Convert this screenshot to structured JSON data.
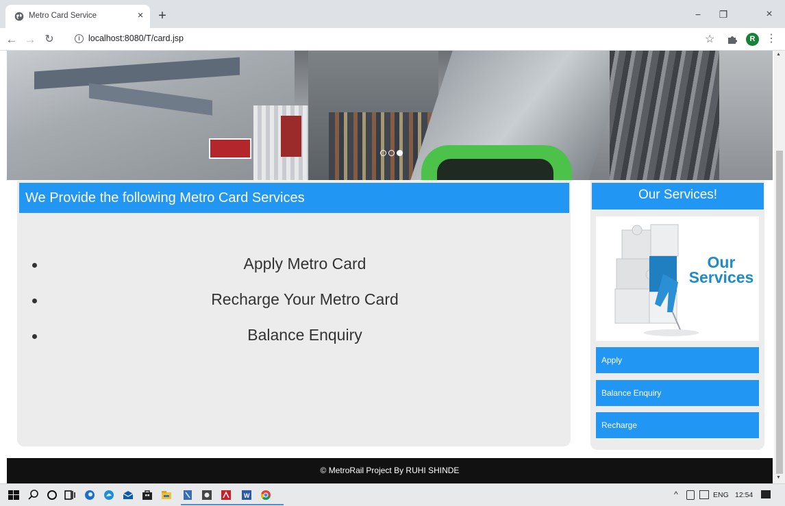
{
  "browser": {
    "tab_title": "Metro Card Service",
    "tab_close": "×",
    "new_tab": "+",
    "url": "localhost:8080/T/card.jsp",
    "profile_initial": "R",
    "window_minimize": "−",
    "window_restore": "❐",
    "window_close": "×"
  },
  "banner": {
    "carousel_total_slides": 3,
    "carousel_active_slide": 3
  },
  "main": {
    "heading": "We Provide the following Metro Card Services",
    "services": [
      "Apply Metro Card",
      "Recharge Your Metro Card",
      "Balance Enquiry"
    ]
  },
  "sidebar": {
    "heading": "Our Services!",
    "image_text_line1": "Our",
    "image_text_line2": "Services",
    "buttons": [
      "Apply",
      "Balance Enquiry",
      "Recharge"
    ]
  },
  "footer": {
    "text": "© MetroRail Project By RUHI SHINDE"
  },
  "taskbar": {
    "language": "ENG",
    "clock": "12:54",
    "pinned_apps": [
      "start",
      "search",
      "cortana",
      "task-view",
      "edge-old",
      "edge",
      "mail",
      "store",
      "file-explorer",
      "notepad-plus",
      "settings",
      "acrobat",
      "word",
      "chrome"
    ]
  },
  "colors": {
    "accent": "#2196f3",
    "panel_bg": "#ececec",
    "footer_bg": "#111111",
    "text_dark": "#333333"
  }
}
